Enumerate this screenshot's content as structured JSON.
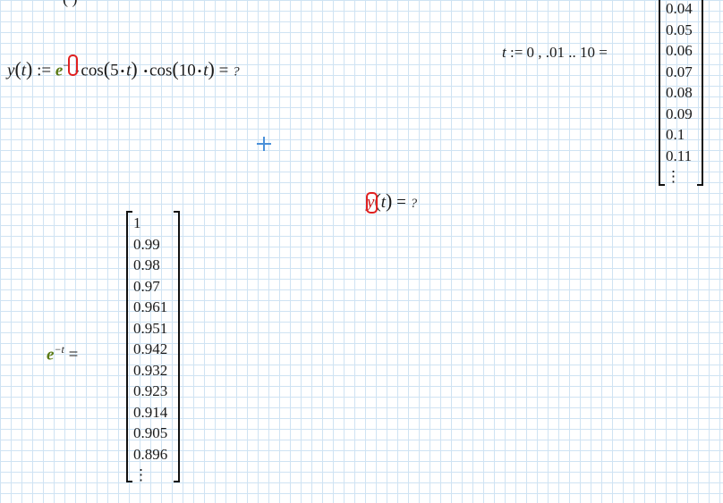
{
  "top_fragment": "(          )",
  "y_def": {
    "lhs": "y",
    "arg": "t",
    "assign": ":=",
    "e": "e",
    "neg": "−",
    "cos": "cos",
    "five": "5",
    "ten": "10",
    "t": "t",
    "equals": "=",
    "result": "?"
  },
  "t_range": {
    "var": "t",
    "assign": ":=",
    "text": "0 , .01 .. 10",
    "equals": "="
  },
  "t_matrix": [
    "0.04",
    "0.05",
    "0.06",
    "0.07",
    "0.08",
    "0.09",
    "0.1",
    "0.11",
    "⋮"
  ],
  "y_eval": {
    "placeholder_fn": "y",
    "arg": "t",
    "equals": "=",
    "result": "?"
  },
  "exp_eval": {
    "base": "e",
    "exponent": "−t",
    "equals": "="
  },
  "exp_matrix": [
    "1",
    "0.99",
    "0.98",
    "0.97",
    "0.961",
    "0.951",
    "0.942",
    "0.932",
    "0.923",
    "0.914",
    "0.905",
    "0.896",
    "⋮"
  ],
  "colors": {
    "grid": "#cfe3f3",
    "placeholder": "#e02020",
    "green_var": "#5a7a14",
    "cursor": "#4a90d9"
  },
  "icons": {
    "cursor": "crosshair-cursor-icon"
  }
}
